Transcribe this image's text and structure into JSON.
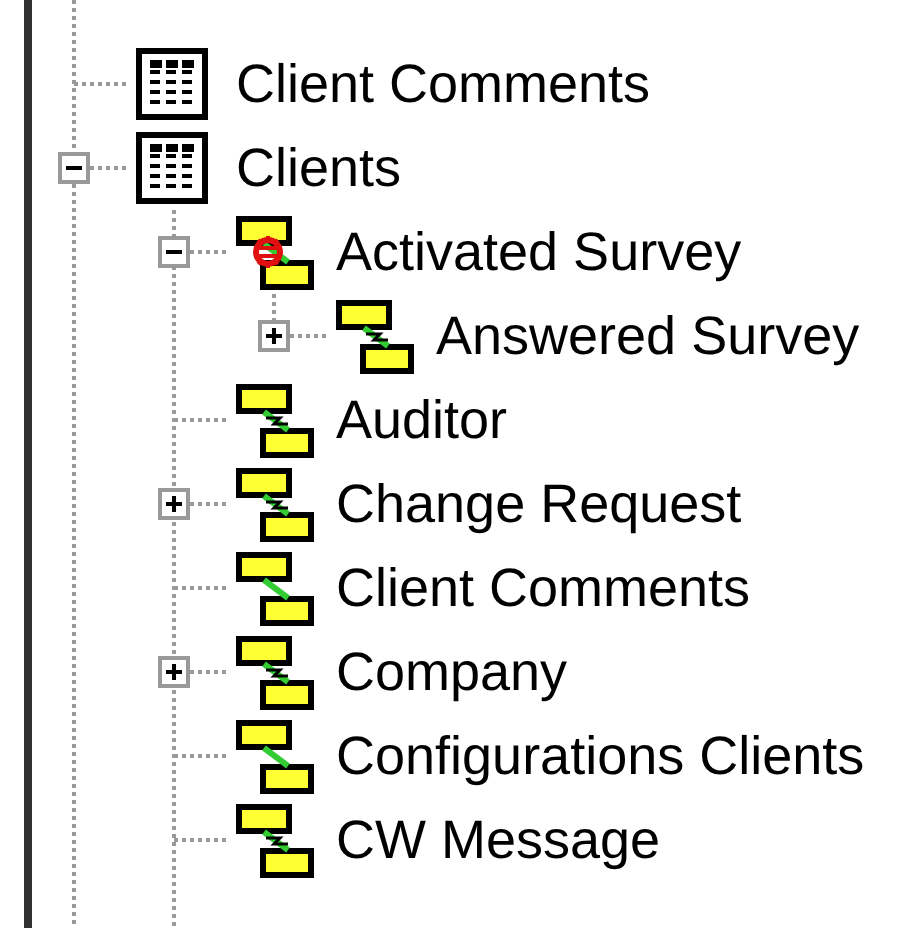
{
  "tree": [
    {
      "label": "Client Comments",
      "kind": "table"
    },
    {
      "label": "Clients",
      "kind": "table",
      "expanded": true,
      "children": [
        {
          "label": "Activated Survey",
          "kind": "entity-error",
          "expanded": true,
          "children": [
            {
              "label": "Answered Survey",
              "kind": "entity",
              "expanded": false
            }
          ]
        },
        {
          "label": "Auditor",
          "kind": "entity"
        },
        {
          "label": "Change Request",
          "kind": "entity",
          "expanded": false
        },
        {
          "label": "Client Comments",
          "kind": "entity-plain"
        },
        {
          "label": "Company",
          "kind": "entity",
          "expanded": false
        },
        {
          "label": "Configurations Clients",
          "kind": "entity-plain"
        },
        {
          "label": "CW Message",
          "kind": "entity"
        }
      ]
    }
  ]
}
